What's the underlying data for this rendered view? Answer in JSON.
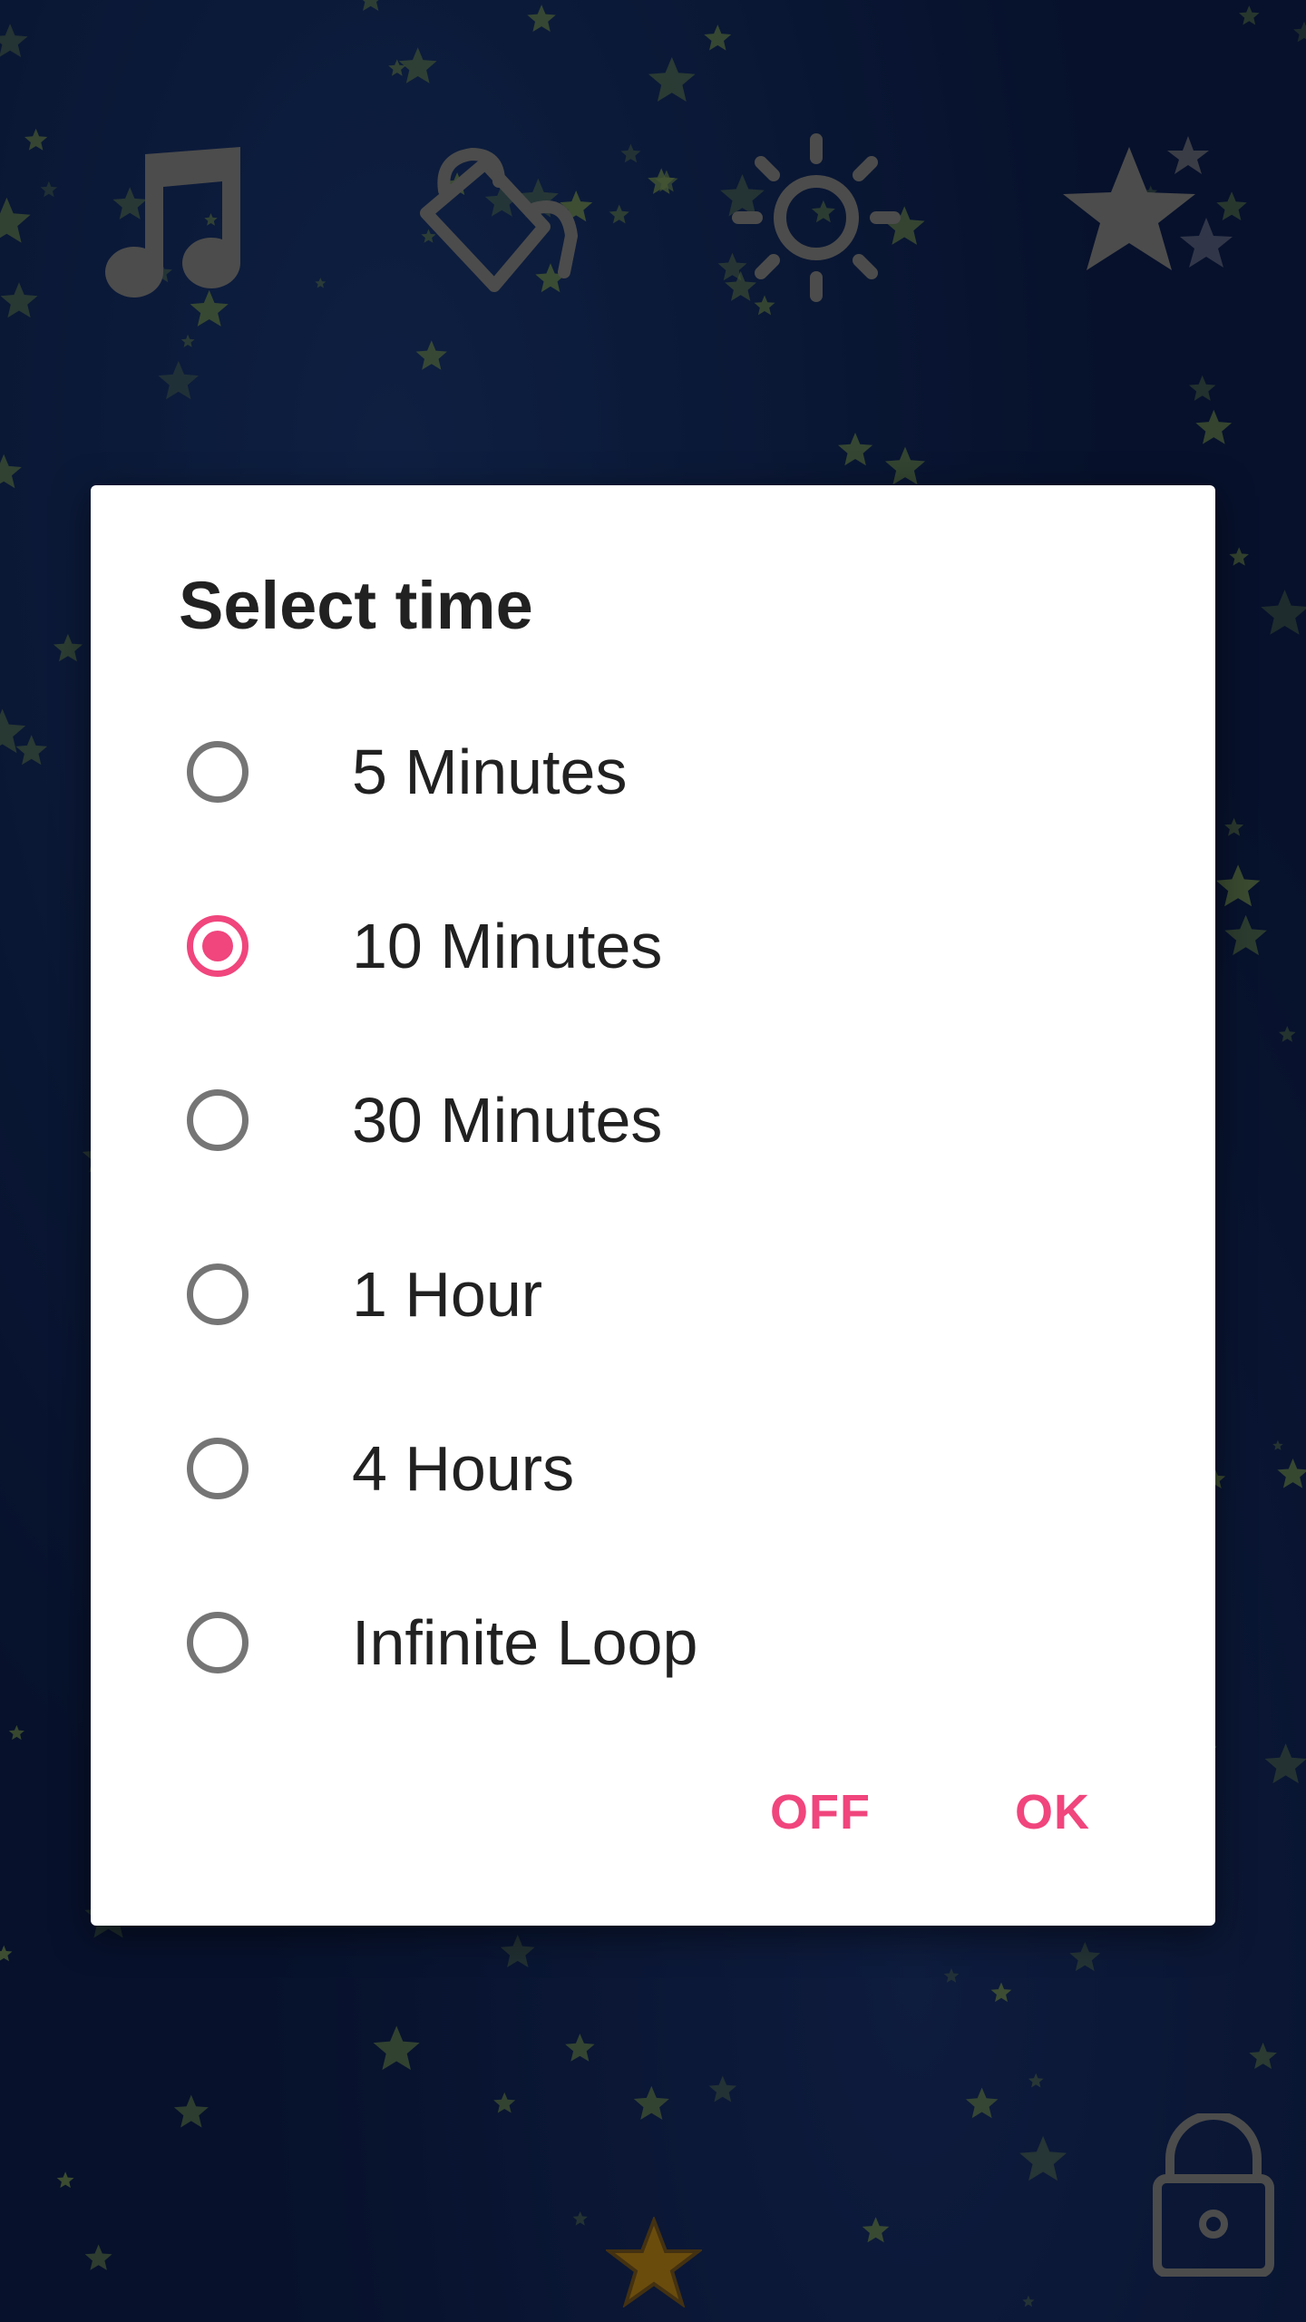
{
  "colors": {
    "accent": "#f0457d",
    "background": "#0d2050",
    "icon": "#8a8a8a",
    "star": "#7fa05a"
  },
  "toolbar": {
    "items": [
      {
        "icon": "music-note-icon"
      },
      {
        "icon": "paint-bucket-icon"
      },
      {
        "icon": "brightness-icon"
      },
      {
        "icon": "favorites-stars-icon"
      }
    ]
  },
  "dialog": {
    "title": "Select time",
    "options": [
      {
        "label": "5 Minutes",
        "selected": false
      },
      {
        "label": "10 Minutes",
        "selected": true
      },
      {
        "label": "30 Minutes",
        "selected": false
      },
      {
        "label": "1 Hour",
        "selected": false
      },
      {
        "label": "4 Hours",
        "selected": false
      },
      {
        "label": "Infinite Loop",
        "selected": false
      }
    ],
    "buttons": {
      "off": "OFF",
      "ok": "OK"
    }
  },
  "bottom": {
    "lock_icon": "unlock-icon",
    "star_icon": "star-icon"
  }
}
